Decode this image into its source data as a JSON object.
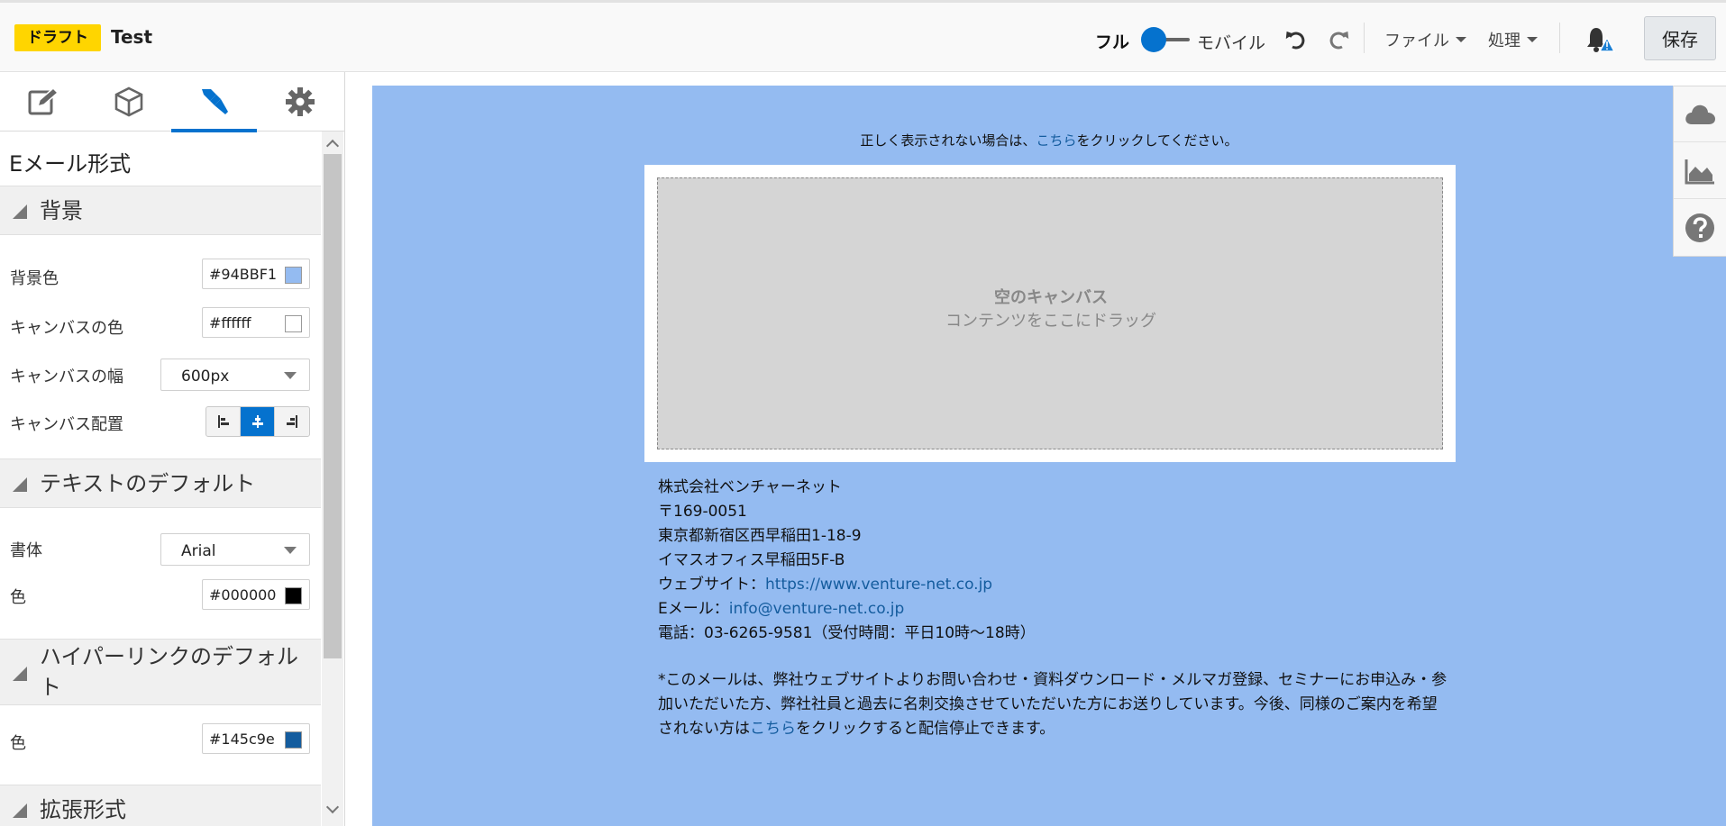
{
  "header": {
    "status_badge": "ドラフト",
    "doc_title": "Test",
    "view_full": "フル",
    "view_mobile": "モバイル",
    "menu_file": "ファイル",
    "menu_actions": "処理",
    "save_label": "保存"
  },
  "left_panel": {
    "pane_title": "Eメール形式",
    "sections": {
      "background": "背景",
      "text_defaults": "テキストのデフォルト",
      "hyperlink_defaults_line1": "ハイパーリンクのデフォル",
      "hyperlink_defaults_line2": "ト",
      "extended": "拡張形式"
    },
    "props": {
      "bg_color_label": "背景色",
      "bg_color_value": "#94BBF1",
      "canvas_color_label": "キャンバスの色",
      "canvas_color_value": "#ffffff",
      "canvas_width_label": "キャンバスの幅",
      "canvas_width_value": "600px",
      "canvas_align_label": "キャンバス配置",
      "font_label": "書体",
      "font_value": "Arial",
      "text_color_label": "色",
      "text_color_value": "#000000",
      "link_color_label": "色",
      "link_color_value": "#145c9e"
    }
  },
  "colors": {
    "accent": "#0572ce",
    "canvas_bg": "#94BBF1",
    "link": "#145c9e",
    "badge": "#ffd500"
  },
  "canvas": {
    "notice_prefix": "正しく表示されない場合は、",
    "notice_link": "こちら",
    "notice_suffix": "をクリックしてください。",
    "empty_title": "空のキャンバス",
    "empty_sub": "コンテンツをここにドラッグ",
    "company": "株式会社ベンチャーネット",
    "postal": "〒169-0051",
    "address1": "東京都新宿区西早稲田1-18-9",
    "address2": "イマスオフィス早稲田5F-B",
    "website_label": "ウェブサイト：",
    "website_url": "https://www.venture-net.co.jp",
    "email_label": "Eメール：",
    "email_value": "info@venture-net.co.jp",
    "phone": "電話：03-6265-9581（受付時間：平日10時～18時）",
    "disclaimer_part1": "*このメールは、弊社ウェブサイトよりお問い合わせ・資料ダウンロード・メルマガ登録、セミナーにお申込み・参加いただいた方、弊社社員と過去に名刺交換させていただいた方にお送りしています。今後、同様のご案内を希望されない方は",
    "disclaimer_link": "こちら",
    "disclaimer_part2": "をクリックすると配信停止できます。"
  },
  "icons": {
    "tab1": "pencil-edit-icon",
    "tab2": "cube-icon",
    "tab3": "paintbrush-icon",
    "tab4": "gear-icon",
    "rail1": "cloud-icon",
    "rail2": "area-chart-icon",
    "rail3": "help-icon"
  }
}
